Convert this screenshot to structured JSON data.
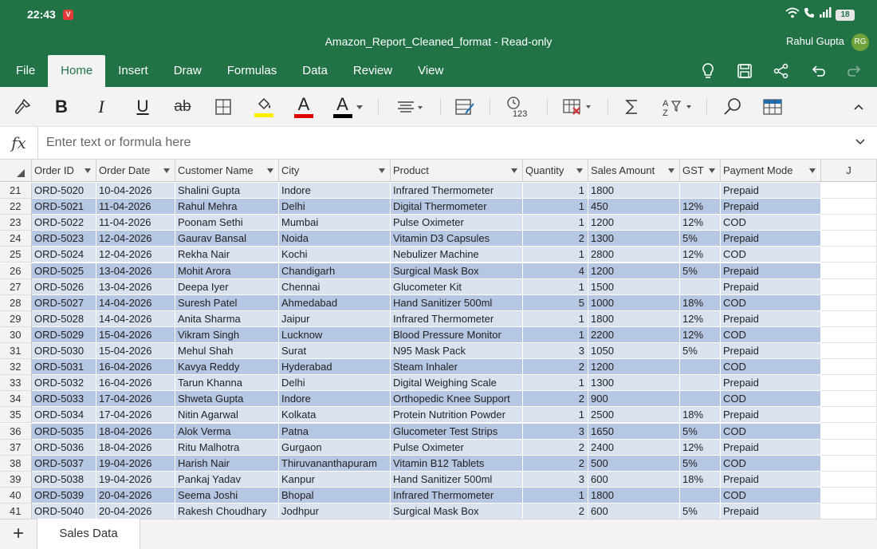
{
  "status_bar": {
    "time": "22:43",
    "app_badge": "V",
    "battery": "18"
  },
  "window": {
    "title": "Amazon_Report_Cleaned_format - Read-only",
    "user_name": "Rahul Gupta",
    "user_initials": "RG"
  },
  "tabs": [
    {
      "label": "File"
    },
    {
      "label": "Home"
    },
    {
      "label": "Insert"
    },
    {
      "label": "Draw"
    },
    {
      "label": "Formulas"
    },
    {
      "label": "Data"
    },
    {
      "label": "Review"
    },
    {
      "label": "View"
    }
  ],
  "active_tab": "Home",
  "ribbon": {
    "bold": "B",
    "italic": "I",
    "underline": "U",
    "strike": "ab",
    "font_color_letter": "A",
    "highlight_color": "#ffee00",
    "font_color": "#e00000",
    "text_color_dark": "#000000"
  },
  "formula_bar": {
    "fx": "fx",
    "placeholder": "Enter text or formula here"
  },
  "columns": [
    "Order ID",
    "Order Date",
    "Customer Name",
    "City",
    "Product",
    "Quantity",
    "Sales Amount",
    "GST",
    "Payment Mode",
    "J"
  ],
  "rows": [
    {
      "n": "21",
      "c": [
        "ORD-5020",
        "10-04-2026",
        "Shalini Gupta",
        "Indore",
        "Infrared Thermometer",
        "1",
        "1800",
        "",
        "Prepaid"
      ]
    },
    {
      "n": "22",
      "c": [
        "ORD-5021",
        "11-04-2026",
        "Rahul Mehra",
        "Delhi",
        "Digital Thermometer",
        "1",
        "450",
        "12%",
        "Prepaid"
      ]
    },
    {
      "n": "23",
      "c": [
        "ORD-5022",
        "11-04-2026",
        "Poonam Sethi",
        "Mumbai",
        "Pulse Oximeter",
        "1",
        "1200",
        "12%",
        "COD"
      ]
    },
    {
      "n": "24",
      "c": [
        "ORD-5023",
        "12-04-2026",
        "Gaurav Bansal",
        "Noida",
        "Vitamin D3 Capsules",
        "2",
        "1300",
        "5%",
        "Prepaid"
      ]
    },
    {
      "n": "25",
      "c": [
        "ORD-5024",
        "12-04-2026",
        "Rekha Nair",
        "Kochi",
        "Nebulizer Machine",
        "1",
        "2800",
        "12%",
        "COD"
      ]
    },
    {
      "n": "26",
      "c": [
        "ORD-5025",
        "13-04-2026",
        "Mohit Arora",
        "Chandigarh",
        "Surgical Mask Box",
        "4",
        "1200",
        "5%",
        "Prepaid"
      ]
    },
    {
      "n": "27",
      "c": [
        "ORD-5026",
        "13-04-2026",
        "Deepa Iyer",
        "Chennai",
        "Glucometer Kit",
        "1",
        "1500",
        "",
        "Prepaid"
      ]
    },
    {
      "n": "28",
      "c": [
        "ORD-5027",
        "14-04-2026",
        "Suresh Patel",
        "Ahmedabad",
        "Hand Sanitizer 500ml",
        "5",
        "1000",
        "18%",
        "COD"
      ]
    },
    {
      "n": "29",
      "c": [
        "ORD-5028",
        "14-04-2026",
        "Anita Sharma",
        "Jaipur",
        "Infrared Thermometer",
        "1",
        "1800",
        "12%",
        "Prepaid"
      ]
    },
    {
      "n": "30",
      "c": [
        "ORD-5029",
        "15-04-2026",
        "Vikram Singh",
        "Lucknow",
        "Blood Pressure Monitor",
        "1",
        "2200",
        "12%",
        "COD"
      ]
    },
    {
      "n": "31",
      "c": [
        "ORD-5030",
        "15-04-2026",
        "Mehul Shah",
        "Surat",
        "N95 Mask Pack",
        "3",
        "1050",
        "5%",
        "Prepaid"
      ]
    },
    {
      "n": "32",
      "c": [
        "ORD-5031",
        "16-04-2026",
        "Kavya Reddy",
        "Hyderabad",
        "Steam Inhaler",
        "2",
        "1200",
        "",
        "COD"
      ]
    },
    {
      "n": "33",
      "c": [
        "ORD-5032",
        "16-04-2026",
        "Tarun Khanna",
        "Delhi",
        "Digital Weighing Scale",
        "1",
        "1300",
        "",
        "Prepaid"
      ]
    },
    {
      "n": "34",
      "c": [
        "ORD-5033",
        "17-04-2026",
        "Shweta Gupta",
        "Indore",
        "Orthopedic Knee Support",
        "2",
        "900",
        "",
        "COD"
      ]
    },
    {
      "n": "35",
      "c": [
        "ORD-5034",
        "17-04-2026",
        "Nitin Agarwal",
        "Kolkata",
        "Protein Nutrition Powder",
        "1",
        "2500",
        "18%",
        "Prepaid"
      ]
    },
    {
      "n": "36",
      "c": [
        "ORD-5035",
        "18-04-2026",
        "Alok Verma",
        "Patna",
        "Glucometer Test Strips",
        "3",
        "1650",
        "5%",
        "COD"
      ]
    },
    {
      "n": "37",
      "c": [
        "ORD-5036",
        "18-04-2026",
        "Ritu Malhotra",
        "Gurgaon",
        "Pulse Oximeter",
        "2",
        "2400",
        "12%",
        "Prepaid"
      ]
    },
    {
      "n": "38",
      "c": [
        "ORD-5037",
        "19-04-2026",
        "Harish Nair",
        "Thiruvananthapuram",
        "Vitamin B12 Tablets",
        "2",
        "500",
        "5%",
        "COD"
      ]
    },
    {
      "n": "39",
      "c": [
        "ORD-5038",
        "19-04-2026",
        "Pankaj Yadav",
        "Kanpur",
        "Hand Sanitizer 500ml",
        "3",
        "600",
        "18%",
        "Prepaid"
      ]
    },
    {
      "n": "40",
      "c": [
        "ORD-5039",
        "20-04-2026",
        "Seema Joshi",
        "Bhopal",
        "Infrared Thermometer",
        "1",
        "1800",
        "",
        "COD"
      ]
    },
    {
      "n": "41",
      "c": [
        "ORD-5040",
        "20-04-2026",
        "Rakesh Choudhary",
        "Jodhpur",
        "Surgical Mask Box",
        "2",
        "600",
        "5%",
        "Prepaid"
      ]
    }
  ],
  "sheet_tabs": [
    {
      "label": "Sales Data"
    }
  ],
  "add_sheet": "+"
}
